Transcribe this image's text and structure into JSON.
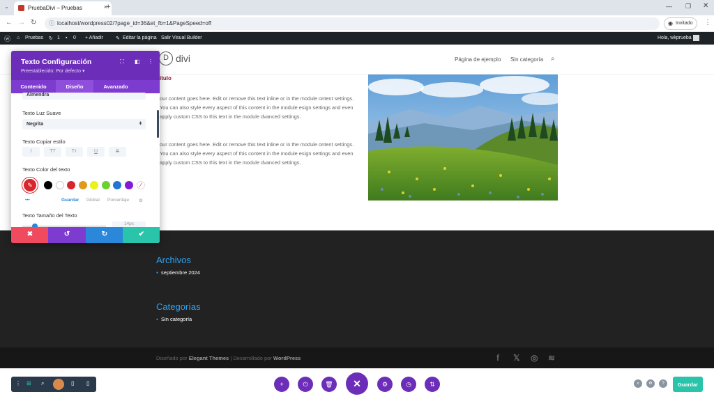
{
  "browser": {
    "tab_title": "PruebaDivi – Pruebas",
    "url": "localhost/wordpress02/?page_id=36&et_fb=1&PageSpeed=off",
    "profile_label": "Invitado"
  },
  "adminbar": {
    "site": "Pruebas",
    "updates": "1",
    "comments": "0",
    "add_new": "+ Añadir",
    "edit_page": "Editar la página",
    "exit_builder": "Salir Visual Builder",
    "greeting": "Hola, wkprueba"
  },
  "site": {
    "logo": "divi",
    "menu": [
      "Página de ejemplo",
      "Sin categoría"
    ]
  },
  "content": {
    "title": "ítulo",
    "paragraph1": "our content goes here. Edit or remove this text inline or in the module ontent settings. You can also style every aspect of this content in the module esign settings and even apply custom CSS to this text in the module dvanced settings.",
    "paragraph2": "our content goes here. Edit or remove this text inline or in the module ontent settings. You can also style every aspect of this content in the module esign settings and even apply custom CSS to this text in the module dvanced settings."
  },
  "footer": {
    "archives_title": "Archivos",
    "archives_item": "septiembre 2024",
    "categories_title": "Categorías",
    "categories_item": "Sin categoría",
    "credit_prefix": "Diseñado por ",
    "credit_brand": "Elegant Themes",
    "credit_mid": " | Desarrollado por ",
    "credit_wp": "WordPress"
  },
  "panel": {
    "title": "Texto Configuración",
    "preset": "Preestablecido: Por defecto ▾",
    "tabs": [
      "Contenido",
      "Diseño",
      "Avanzado"
    ],
    "font_value": "Almendra",
    "light_label": "Texto Luz Suave",
    "weight_value": "Negrita",
    "style_label": "Texto Copiar estilo",
    "style_buttons": [
      "I",
      "TT",
      "Tт",
      "U",
      "S"
    ],
    "color_label": "Texto Color del texto",
    "color_links": [
      "Guardar",
      "Global",
      "Porcentaje"
    ],
    "size_label": "Texto Tamaño del Texto",
    "size_value": "14px",
    "swatches": [
      "#000000",
      "#ffffff",
      "#d9252c",
      "#e09a1a",
      "#e8f21c",
      "#6ad12f",
      "#2175d6",
      "#8419d9"
    ],
    "selected_color": "#d9252c"
  },
  "builder": {
    "save_label": "Guardar"
  }
}
